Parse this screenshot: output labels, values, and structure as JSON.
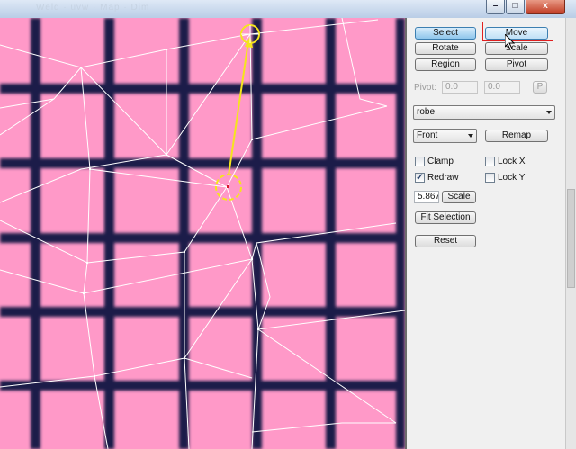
{
  "window": {
    "title_faded": "Weld  ·  uvw  ·  Map  ·  Dim",
    "buttons": [
      "–",
      "□",
      "x"
    ]
  },
  "viewport": {
    "colors": {
      "fill": "#ff99c8",
      "grid": "#1e1f4a",
      "wire": "#ffffff",
      "highlight": "#f5e51c"
    }
  },
  "panel": {
    "select": "Select",
    "move": "Move",
    "rotate": "Rotate",
    "scale": "Scale",
    "region": "Region",
    "pivot": "Pivot",
    "pivot_label": "Pivot:",
    "pivot_x": "0.0",
    "pivot_y": "0.0",
    "pivot_p": "P",
    "material": "robe",
    "view": "Front",
    "remap": "Remap",
    "clamp": "Clamp",
    "lock_x": "Lock X",
    "redraw": "Redraw",
    "lock_y": "Lock Y",
    "scale_value": "5.867",
    "scale_button": "Scale",
    "fit_selection": "Fit Selection",
    "reset": "Reset"
  },
  "state": {
    "active_tool": "select",
    "hovered_tool": "move",
    "clamp": false,
    "redraw": true,
    "lock_x": false,
    "lock_y": false
  }
}
